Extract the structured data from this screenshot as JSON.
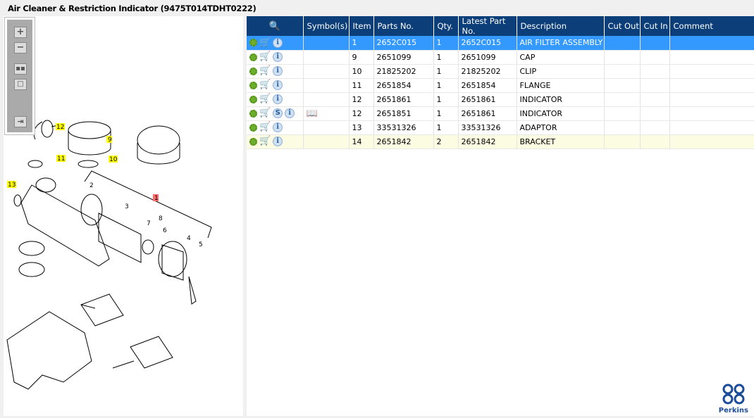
{
  "title": "Air Cleaner & Restriction Indicator (9475T014TDHT0222)",
  "toolbar": [
    "zoom-in",
    "zoom-out",
    "fit-all",
    "fit-page",
    "export"
  ],
  "table": {
    "headers": [
      "",
      "Symbol(s)",
      "Item",
      "Parts No.",
      "Qty.",
      "Latest Part No.",
      "Description",
      "Cut Out",
      "Cut In",
      "Comment"
    ],
    "rows": [
      {
        "item": "1",
        "part": "2652C015",
        "qty": "1",
        "latest": "2652C015",
        "desc": "AIR FILTER ASSEMBLY",
        "s": false,
        "book": false
      },
      {
        "item": "9",
        "part": "2651099",
        "qty": "1",
        "latest": "2651099",
        "desc": "CAP",
        "s": false,
        "book": false
      },
      {
        "item": "10",
        "part": "21825202",
        "qty": "1",
        "latest": "21825202",
        "desc": "CLIP",
        "s": false,
        "book": false
      },
      {
        "item": "11",
        "part": "2651854",
        "qty": "1",
        "latest": "2651854",
        "desc": "FLANGE",
        "s": false,
        "book": false
      },
      {
        "item": "12",
        "part": "2651861",
        "qty": "1",
        "latest": "2651861",
        "desc": "INDICATOR",
        "s": false,
        "book": false
      },
      {
        "item": "12",
        "part": "2651851",
        "qty": "1",
        "latest": "2651861",
        "desc": "INDICATOR",
        "s": true,
        "book": true
      },
      {
        "item": "13",
        "part": "33531326",
        "qty": "1",
        "latest": "33531326",
        "desc": "ADAPTOR",
        "s": false,
        "book": false
      },
      {
        "item": "14",
        "part": "2651842",
        "qty": "2",
        "latest": "2651842",
        "desc": "BRACKET",
        "s": false,
        "book": false
      }
    ],
    "s_label": "S",
    "info_label": "i"
  },
  "callouts": {
    "c12": "12",
    "c9": "9",
    "c11": "11",
    "c10": "10",
    "c13": "13",
    "c1": "1",
    "n2": "2",
    "n3": "3",
    "n4": "4",
    "n5": "5",
    "n6": "6",
    "n7": "7",
    "n8": "8"
  },
  "logo": {
    "text": "Perkins"
  }
}
